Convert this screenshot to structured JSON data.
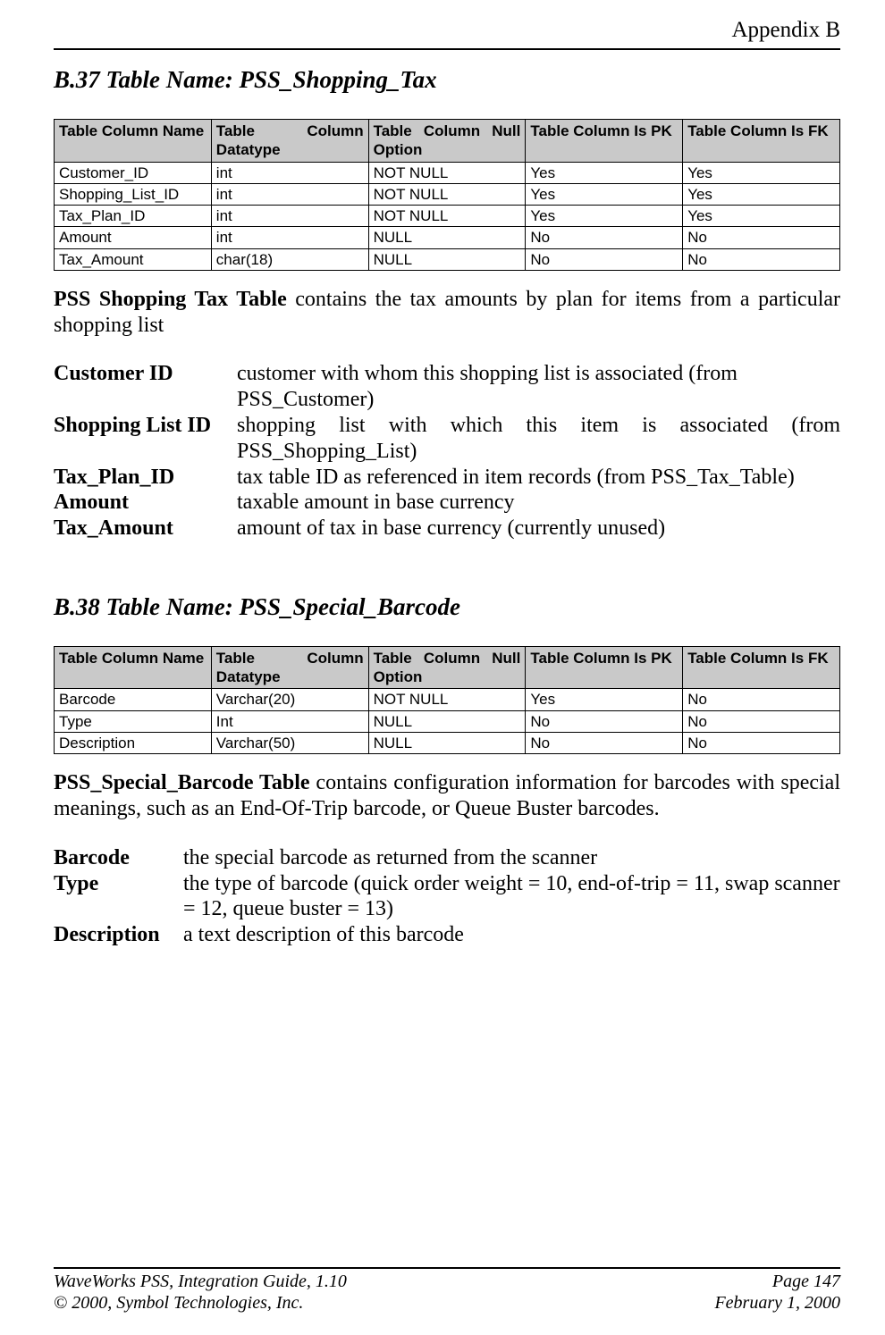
{
  "header": {
    "appendix": "Appendix B"
  },
  "section_b37": {
    "title": "B.37  Table Name: PSS_Shopping_Tax",
    "columns": {
      "c1": "Table Column Name",
      "c2a": "Table",
      "c2b": "Column",
      "c2_line2": "Datatype",
      "c3a": "Table",
      "c3b": "Column",
      "c3c": "Null",
      "c3_line2": "Option",
      "c4": "Table Column Is PK",
      "c5": "Table Column Is FK"
    },
    "rows": [
      {
        "name": "Customer_ID",
        "dtype": "int",
        "nullopt": "NOT NULL",
        "pk": "Yes",
        "fk": "Yes"
      },
      {
        "name": "Shopping_List_ID",
        "dtype": "int",
        "nullopt": "NOT NULL",
        "pk": "Yes",
        "fk": "Yes"
      },
      {
        "name": "Tax_Plan_ID",
        "dtype": "int",
        "nullopt": "NOT NULL",
        "pk": "Yes",
        "fk": "Yes"
      },
      {
        "name": "Amount",
        "dtype": "int",
        "nullopt": "NULL",
        "pk": "No",
        "fk": "No"
      },
      {
        "name": "Tax_Amount",
        "dtype": "char(18)",
        "nullopt": "NULL",
        "pk": "No",
        "fk": "No"
      }
    ],
    "para_bold": "PSS Shopping Tax Table",
    "para_rest": " contains the tax amounts by plan for items from a particular shopping list",
    "descs": [
      {
        "term": "Customer ID",
        "def": "customer with whom this shopping list is associated (from PSS_Customer)"
      },
      {
        "term": "Shopping List ID",
        "def": "shopping list with which this item is associated (from PSS_Shopping_List)"
      },
      {
        "term": "Tax_Plan_ID",
        "def": "tax table ID as referenced in item records (from PSS_Tax_Table)"
      },
      {
        "term": "Amount",
        "def": "taxable amount in base currency"
      },
      {
        "term": "Tax_Amount",
        "def": "amount of tax in base currency (currently unused)"
      }
    ]
  },
  "section_b38": {
    "title": "B.38  Table Name: PSS_Special_Barcode",
    "rows": [
      {
        "name": "Barcode",
        "dtype": "Varchar(20)",
        "nullopt": "NOT NULL",
        "pk": "Yes",
        "fk": "No"
      },
      {
        "name": "Type",
        "dtype": "Int",
        "nullopt": "NULL",
        "pk": "No",
        "fk": "No"
      },
      {
        "name": "Description",
        "dtype": "Varchar(50)",
        "nullopt": "NULL",
        "pk": "No",
        "fk": "No"
      }
    ],
    "para_bold": "PSS_Special_Barcode Table",
    "para_rest": " contains configuration information for barcodes with special meanings, such as an End-Of-Trip barcode, or Queue Buster barcodes.",
    "descs": [
      {
        "term": "Barcode",
        "def": "the special barcode as returned from the scanner"
      },
      {
        "term": "Type",
        "def": "the type of barcode (quick order weight = 10, end-of-trip = 11, swap scanner = 12, queue buster = 13)"
      },
      {
        "term": "Description",
        "def": "a text description of this barcode"
      }
    ]
  },
  "footer": {
    "l1_left": "WaveWorks PSS, Integration Guide, 1.10",
    "l1_right": "Page 147",
    "l2_left": "© 2000, Symbol Technologies, Inc.",
    "l2_right": "February 1, 2000"
  }
}
